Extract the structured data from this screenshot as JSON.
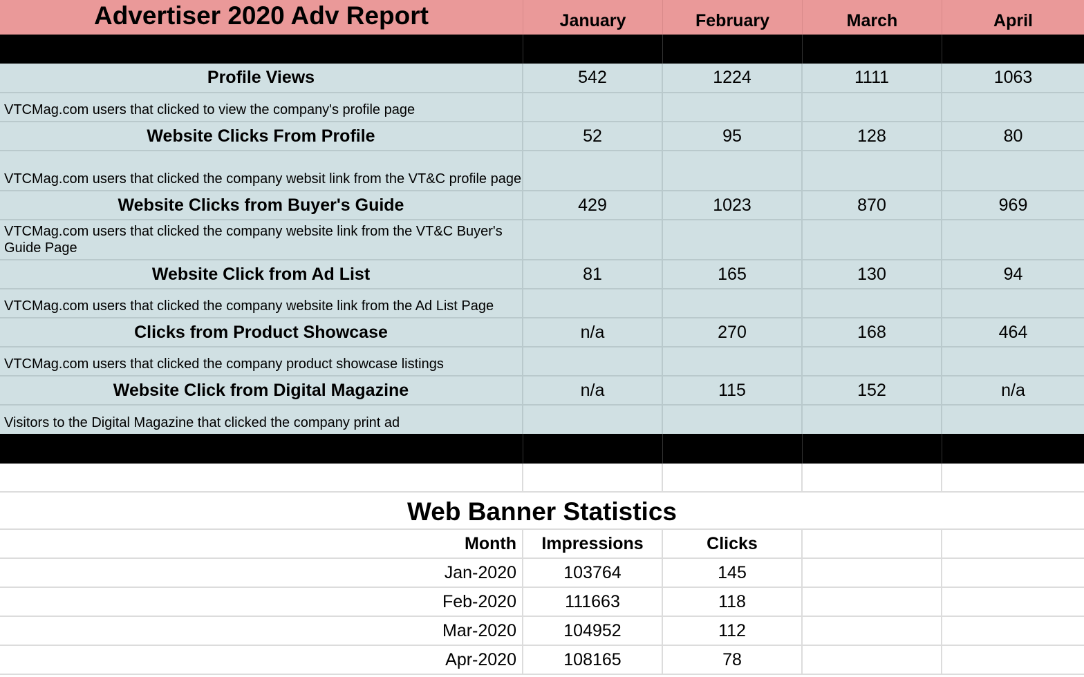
{
  "header": {
    "title": "Advertiser 2020 Adv Report",
    "months": [
      "January",
      "February",
      "March",
      "April"
    ]
  },
  "metrics": [
    {
      "name": "Profile Views",
      "values": [
        "542",
        "1224",
        "1111",
        "1063"
      ],
      "description": "VTCMag.com users that clicked to view the company's profile page"
    },
    {
      "name": "Website Clicks From Profile",
      "values": [
        "52",
        "95",
        "128",
        "80"
      ],
      "description": "VTCMag.com users that clicked the company websit link from the VT&C profile page"
    },
    {
      "name": "Website Clicks from Buyer's Guide",
      "values": [
        "429",
        "1023",
        "870",
        "969"
      ],
      "description": "VTCMag.com users that clicked the company website link from the VT&C Buyer's Guide Page"
    },
    {
      "name": "Website Click from Ad List",
      "values": [
        "81",
        "165",
        "130",
        "94"
      ],
      "description": "VTCMag.com users that clicked the company website link from the Ad List Page"
    },
    {
      "name": "Clicks from Product Showcase",
      "values": [
        "n/a",
        "270",
        "168",
        "464"
      ],
      "description": "VTCMag.com users that clicked the company product showcase listings"
    },
    {
      "name": "Website Click from Digital Magazine",
      "values": [
        "n/a",
        "115",
        "152",
        "n/a"
      ],
      "description": "Visitors to the Digital Magazine that clicked the company print ad"
    }
  ],
  "banner": {
    "title": "Web Banner Statistics",
    "columns": [
      "Month",
      "Impressions",
      "Clicks"
    ],
    "rows": [
      [
        "Jan-2020",
        "103764",
        "145"
      ],
      [
        "Feb-2020",
        "111663",
        "118"
      ],
      [
        "Mar-2020",
        "104952",
        "112"
      ],
      [
        "Apr-2020",
        "108165",
        "78"
      ]
    ]
  },
  "colors": {
    "header_bg": "#ea9999",
    "data_bg": "#d0e0e3",
    "bar": "#000000"
  }
}
